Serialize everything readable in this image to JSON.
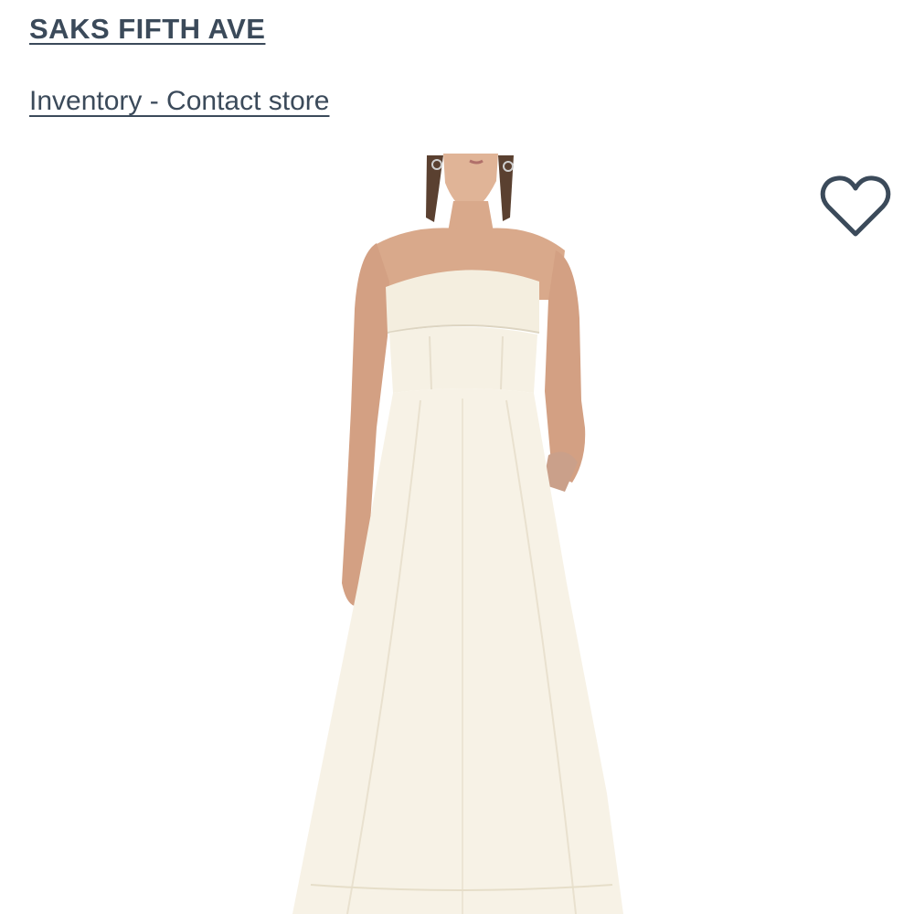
{
  "header": {
    "store_name": "SAKS FIFTH AVE",
    "inventory_link": "Inventory - Contact store"
  },
  "product": {
    "image_icon": "product-photo-strapless-maxi-dress",
    "favorite_icon": "heart-outline-icon"
  },
  "colors": {
    "text": "#3b4a5a",
    "dress": "#f7f2e6",
    "skin": "#d9a98b",
    "hair": "#5a4030"
  }
}
